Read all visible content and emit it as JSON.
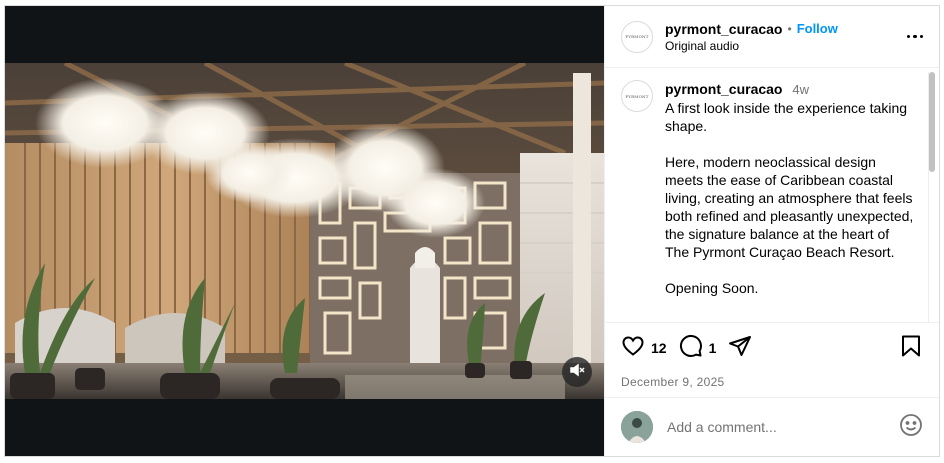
{
  "post": {
    "username": "pyrmont_curacao",
    "follow_label": "Follow",
    "audio": "Original audio",
    "avatar_text": "PYRMONT",
    "caption": {
      "time": "4w",
      "text": "A first look inside the experience taking shape.\n\nHere, modern neoclassical design meets the ease of Caribbean coastal living, creating an atmosphere that feels both refined and pleasantly unexpected, the signature balance at the heart of The Pyrmont Curaçao Beach Resort.\n\nOpening Soon."
    },
    "likes": "12",
    "comments": "1",
    "date": "December 9, 2025",
    "comment_placeholder": "Add a comment..."
  },
  "icons": {
    "like": "heart-icon",
    "comment": "comment-icon",
    "share": "share-icon",
    "save": "bookmark-icon",
    "more": "more-icon",
    "mute": "muted-speaker-icon",
    "emoji": "emoji-icon"
  },
  "colors": {
    "accent": "#0095f6",
    "muted_text": "#737373"
  }
}
